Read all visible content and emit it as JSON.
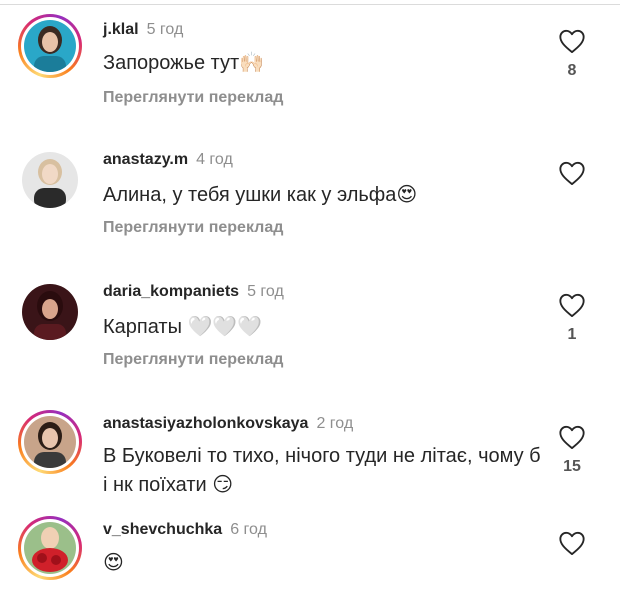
{
  "comments": [
    {
      "username": "j.klal",
      "time": "5 год",
      "text": "Запорожье тут",
      "emoji": "🙌🏻",
      "translate": "Переглянути переклад",
      "likes": "8",
      "avatar_color": "#2aa7c8"
    },
    {
      "username": "anastazy.m",
      "time": "4 год",
      "text": "Алина, у тебя ушки как у эльфа",
      "emoji": "😍",
      "translate": "Переглянути переклад",
      "likes": "",
      "avatar_color": "#cfcfcf"
    },
    {
      "username": "daria_kompaniets",
      "time": "5 год",
      "text": "Карпаты ",
      "emoji": "🤍🤍🤍",
      "translate": "Переглянути переклад",
      "likes": "1",
      "avatar_color": "#3a1418"
    },
    {
      "username": "anastasiyazholonkovskaya",
      "time": "2 год",
      "text": "В Буковелі то тихо, нічого туди не літає, чому б і нк поїхати",
      "emoji": "😏",
      "translate": "",
      "likes": "15",
      "avatar_color": "#c8a48a"
    },
    {
      "username": "v_shevchuchka",
      "time": "6 год",
      "text": "",
      "emoji": "😍",
      "translate": "",
      "likes": "",
      "avatar_color": "#d0202a"
    }
  ],
  "icons": {
    "like": "heart-outline-icon"
  },
  "colors": {
    "username": "#262626",
    "secondary": "#8e8e8e",
    "story_ring": "#d62976"
  }
}
